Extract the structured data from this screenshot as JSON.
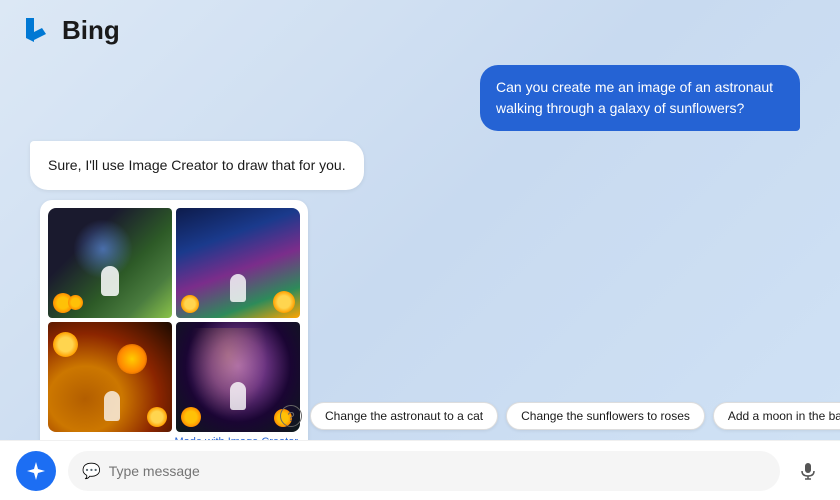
{
  "header": {
    "logo_text": "Bing",
    "logo_icon": "bing-logo"
  },
  "chat": {
    "user_message": "Can you create me an image of an astronaut walking through a galaxy of sunflowers?",
    "bot_message": "Sure, I'll use Image Creator to draw that for you.",
    "image_attribution_prefix": "Made with ",
    "image_attribution_link": "Image Creator",
    "images": [
      {
        "id": "img-1",
        "alt": "Astronaut with galaxy and plants"
      },
      {
        "id": "img-2",
        "alt": "Astronaut among sunflowers and galaxy"
      },
      {
        "id": "img-3",
        "alt": "Astronaut in sunflower field with nebula"
      },
      {
        "id": "img-4",
        "alt": "Astronaut in spiral galaxy with sunflowers"
      }
    ]
  },
  "suggestions": {
    "help_icon": "?",
    "chips": [
      {
        "id": "chip-1",
        "label": "Change the astronaut to a cat"
      },
      {
        "id": "chip-2",
        "label": "Change the sunflowers to roses"
      },
      {
        "id": "chip-3",
        "label": "Add a moon in the background"
      }
    ]
  },
  "input_bar": {
    "placeholder": "Type message",
    "bing_icon": "✦",
    "message_icon": "💬",
    "mic_icon": "🎤"
  }
}
